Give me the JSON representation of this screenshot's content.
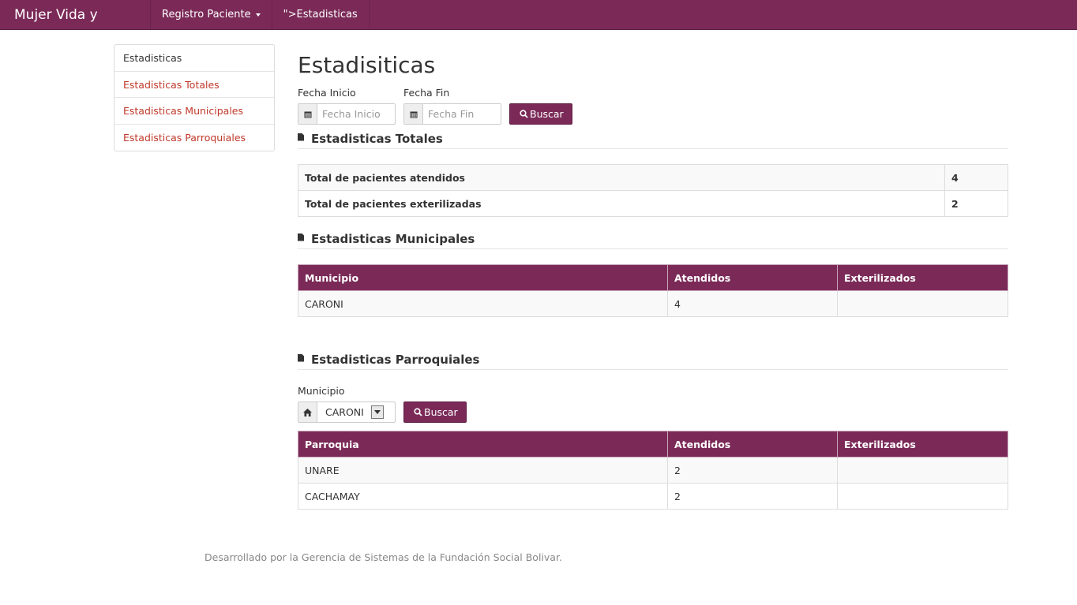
{
  "navbar": {
    "brand": "Mujer Vida y Futuro",
    "registro_label": "Registro Paciente",
    "estadisticas_label": "\">Estadisticas"
  },
  "sidebar": {
    "header": "Estadisticas",
    "items": [
      {
        "label": "Estadisticas Totales"
      },
      {
        "label": "Estadisticas Municipales"
      },
      {
        "label": "Estadisticas Parroquiales"
      }
    ]
  },
  "page": {
    "title": "Estadisiticas"
  },
  "filters": {
    "fecha_inicio_label": "Fecha Inicio",
    "fecha_inicio_placeholder": "Fecha Inicio",
    "fecha_fin_label": "Fecha Fin",
    "fecha_fin_placeholder": "Fecha Fin",
    "buscar_label": "Buscar"
  },
  "totales": {
    "title": "Estadisticas Totales",
    "rows": [
      {
        "label": "Total de pacientes atendidos",
        "value": "4"
      },
      {
        "label": "Total de pacientes exterilizadas",
        "value": "2"
      }
    ]
  },
  "municipales": {
    "title": "Estadisticas Municipales",
    "headers": [
      "Municipio",
      "Atendidos",
      "Exterilizados"
    ],
    "rows": [
      {
        "municipio": "CARONI",
        "atendidos": "4",
        "exterilizados": ""
      }
    ]
  },
  "parroquiales": {
    "title": "Estadisticas Parroquiales",
    "municipio_label": "Municipio",
    "municipio_selected": "CARONI",
    "buscar_label": "Buscar",
    "headers": [
      "Parroquia",
      "Atendidos",
      "Exterilizados"
    ],
    "rows": [
      {
        "parroquia": "UNARE",
        "atendidos": "2",
        "exterilizados": ""
      },
      {
        "parroquia": "CACHAMAY",
        "atendidos": "2",
        "exterilizados": ""
      }
    ]
  },
  "footer": {
    "text": "Desarrollado por la Gerencia de Sistemas de la Fundación Social Bolivar."
  },
  "colors": {
    "brand": "#7b2a58",
    "link": "#c0392b"
  },
  "icons": {
    "calendar": "calendar-icon",
    "search": "search-icon",
    "document": "file-icon",
    "home": "home-icon"
  }
}
